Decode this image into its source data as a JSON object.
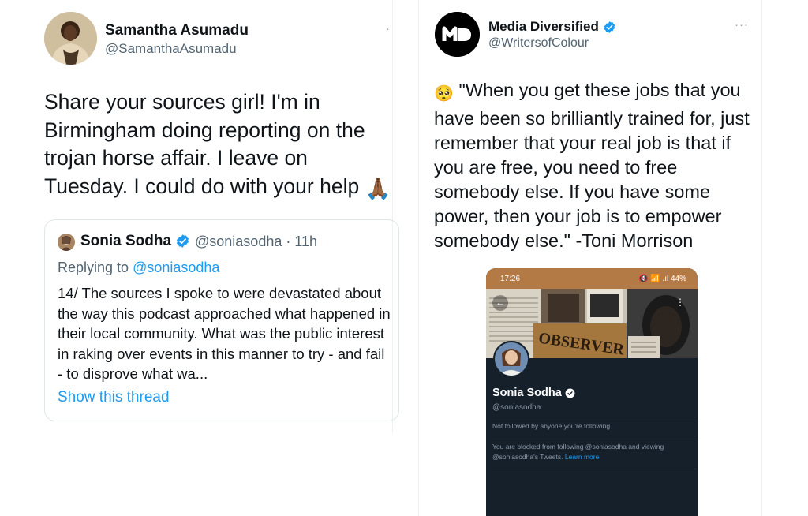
{
  "left_tweet": {
    "author_name": "Samantha Asumadu",
    "author_handle": "@SamanthaAsumadu",
    "more_icon": "more-icon",
    "text": "Share your sources girl! I'm in Birmingham doing reporting on the trojan horse affair. I leave on Tuesday. I could do with your help",
    "emoji": "🙏🏾",
    "quoted": {
      "author_name": "Sonia Sodha",
      "verified_icon": "verified-badge-icon",
      "author_handle_time": "@soniasodha · 11h",
      "replying_prefix": "Replying to ",
      "replying_handle": "@soniasodha",
      "text": "14/ The sources I spoke to were devastated about the way this podcast approached what happened in their local community. What was the public interest in raking over events in this manner to try - and fail - to disprove what wa...",
      "show_thread": "Show this thread"
    }
  },
  "right_tweet": {
    "author_name": "Media Diversified",
    "author_handle": "@WritersofColour",
    "avatar_text": "MD",
    "more_icon": "more-icon",
    "emoji": "🥺",
    "text": "\"When you get these jobs that you have been so brilliantly trained for, just remember that your real job is that if you are free, you need to free somebody else. If you have some power, then your job is to empower somebody else.\" -Toni Morrison",
    "screenshot": {
      "status_time": "17:26",
      "status_icons": "🔇 📶 .ıl 44%",
      "banner_word": "OBSERVER",
      "profile_name": "Sonia Sodha",
      "profile_handle": "@soniasodha",
      "followed_text": "Not followed by anyone you're following",
      "blocked_text": "You are blocked from following @soniasodha and viewing @soniasodha's Tweets.",
      "learn_more": "Learn more"
    }
  },
  "colors": {
    "link_blue": "#1d9bf0",
    "verified_blue": "#1d9bf0",
    "dark_bg": "#15202b",
    "status_bar": "#b47a46"
  }
}
